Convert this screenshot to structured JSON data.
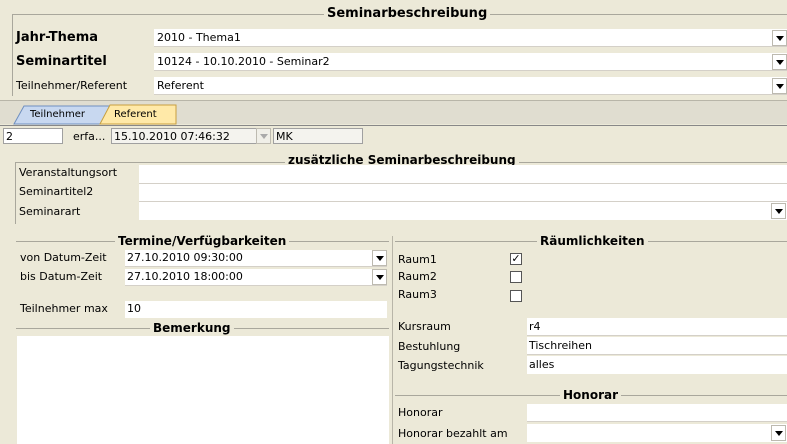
{
  "header": {
    "title": "Seminarbeschreibung",
    "fields": [
      {
        "label": "Jahr-Thema",
        "value": "2010 - Thema1"
      },
      {
        "label": "Seminartitel",
        "value": "10124 - 10.10.2010 - Seminar2"
      },
      {
        "label": "Teilnehmer/Referent",
        "value": "Referent"
      }
    ]
  },
  "tabs": [
    {
      "label": "Teilnehmer",
      "active": false
    },
    {
      "label": "Referent",
      "active": true
    }
  ],
  "record": {
    "number": "2",
    "erfa_label": "erfa...",
    "datetime": "15.10.2010 07:46:32",
    "user": "MK"
  },
  "extra": {
    "title": "zusätzliche Seminarbeschreibung",
    "fields": [
      {
        "label": "Veranstaltungsort",
        "value": ""
      },
      {
        "label": "Seminartitel2",
        "value": ""
      },
      {
        "label": "Seminarart",
        "value": ""
      }
    ]
  },
  "termine": {
    "title": "Termine/Verfügbarkeiten",
    "von_label": "von Datum-Zeit",
    "von_value": "27.10.2010 09:30:00",
    "bis_label": "bis Datum-Zeit",
    "bis_value": "27.10.2010 18:00:00",
    "max_label": "Teilnehmer max",
    "max_value": "10"
  },
  "bemerkung": {
    "title": "Bemerkung"
  },
  "raeume": {
    "title": "Räumlichkeiten",
    "rooms": [
      {
        "label": "Raum1",
        "checked": true
      },
      {
        "label": "Raum2",
        "checked": false
      },
      {
        "label": "Raum3",
        "checked": false
      }
    ],
    "kursraum_label": "Kursraum",
    "kursraum_value": "r4",
    "bestuhlung_label": "Bestuhlung",
    "bestuhlung_value": "Tischreihen",
    "technik_label": "Tagungstechnik",
    "technik_value": "alles"
  },
  "honorar": {
    "title": "Honorar",
    "honorar_label": "Honorar",
    "honorar_value": "",
    "bezahlt_label": "Honorar bezahlt am",
    "bezahlt_value": ""
  },
  "colors": {
    "background": "#ece9d8",
    "active_tab": "#ffe9a8",
    "inactive_tab": "#c8d8f0"
  }
}
